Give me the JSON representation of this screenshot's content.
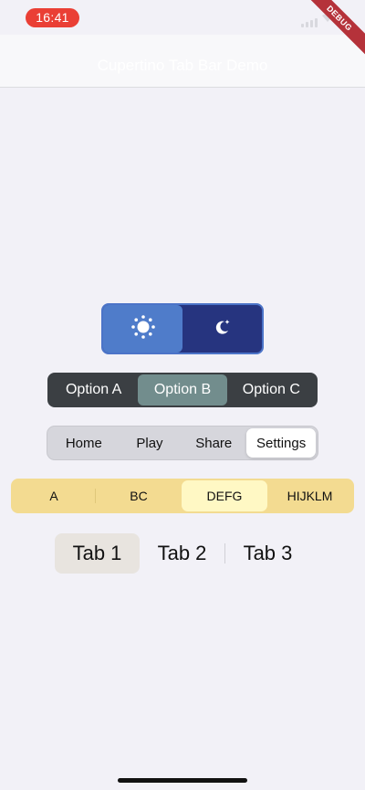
{
  "status_bar": {
    "time": "16:41"
  },
  "debug_banner": {
    "label": "DEBUG"
  },
  "nav_bar": {
    "title": "Cupertino Tab Bar Demo"
  },
  "theme_toggle": {
    "segments": [
      {
        "icon": "sun-icon",
        "selected": true
      },
      {
        "icon": "moon-icon",
        "selected": false
      }
    ],
    "colors": {
      "active": "#4f7cca",
      "inactive": "#26347f"
    }
  },
  "option_control": {
    "segments": [
      {
        "label": "Option A",
        "selected": false
      },
      {
        "label": "Option B",
        "selected": true
      },
      {
        "label": "Option C",
        "selected": false
      }
    ],
    "colors": {
      "background": "#3b3f43",
      "active": "#728d8d"
    }
  },
  "nav_segment_control": {
    "segments": [
      {
        "label": "Home",
        "selected": false
      },
      {
        "label": "Play",
        "selected": false
      },
      {
        "label": "Share",
        "selected": false
      },
      {
        "label": "Settings",
        "selected": true
      }
    ]
  },
  "alpha_control": {
    "segments": [
      {
        "label": "A",
        "selected": false
      },
      {
        "label": "BC",
        "selected": false
      },
      {
        "label": "DEFG",
        "selected": true
      },
      {
        "label": "HIJKLM",
        "selected": false
      }
    ],
    "colors": {
      "background": "#f3db91",
      "active": "#fff8c4"
    }
  },
  "tab_control": {
    "segments": [
      {
        "label": "Tab 1",
        "selected": true
      },
      {
        "label": "Tab 2",
        "selected": false
      },
      {
        "label": "Tab 3",
        "selected": false
      }
    ]
  }
}
